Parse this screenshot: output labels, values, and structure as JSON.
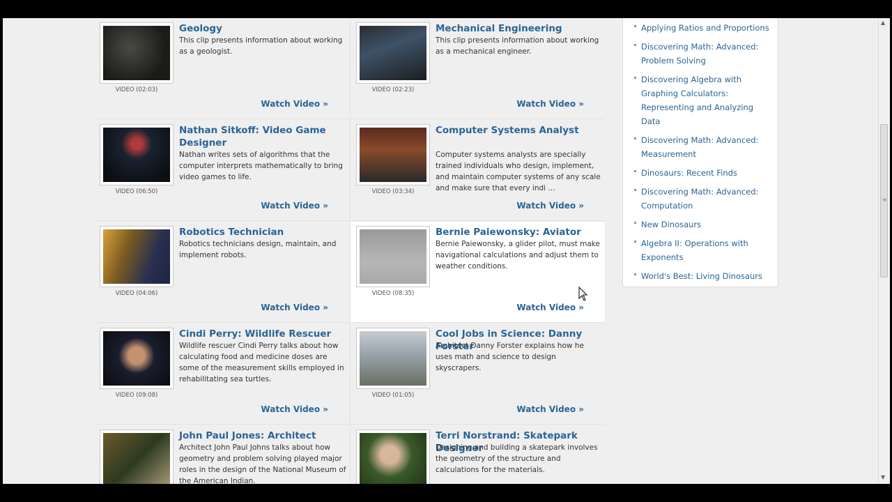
{
  "videos": [
    {
      "title": "Geology",
      "desc": "This clip presents information about working as a geologist.",
      "duration": "VIDEO (02:03)",
      "watch": "Watch Video »",
      "thumb": "t-geology"
    },
    {
      "title": "Mechanical Engineering",
      "desc": "This clip presents information about working as a mechanical engineer.",
      "duration": "VIDEO (02:23)",
      "watch": "Watch Video »",
      "thumb": "t-mech"
    },
    {
      "title": "Nathan Sitkoff: Video Game Designer",
      "desc": "Nathan writes sets of algorithms that the computer interprets mathematically to bring video games to life.",
      "duration": "VIDEO (06:50)",
      "watch": "Watch Video »",
      "thumb": "t-nathan"
    },
    {
      "title": "Computer Systems Analyst",
      "desc": "Computer systems analysts are specially trained individuals who design, implement, and maintain computer systems of any scale and make sure that every indi ...",
      "duration": "VIDEO (03:34)",
      "watch": "Watch Video »",
      "thumb": "t-systems"
    },
    {
      "title": "Robotics Technician",
      "desc": "Robotics technicians design, maintain, and implement robots.",
      "duration": "VIDEO (04:06)",
      "watch": "Watch Video »",
      "thumb": "t-robotics"
    },
    {
      "title": "Bernie Paiewonsky: Aviator",
      "desc": "Bernie Paiewonsky, a glider pilot, must make navigational calculations and adjust them to weather conditions.",
      "duration": "VIDEO (08:35)",
      "watch": "Watch Video »",
      "thumb": "t-bernie"
    },
    {
      "title": "Cindi Perry: Wildlife Rescuer",
      "desc": "Wildlife rescuer Cindi Perry talks about how calculating food and medicine doses are some of the measurement skills employed in rehabilitating sea turtles.",
      "duration": "VIDEO (09:08)",
      "watch": "Watch Video »",
      "thumb": "t-cindi"
    },
    {
      "title": "Cool Jobs in Science: Danny Forster",
      "desc": "Architect Danny Forster explains how he uses math and science to design skyscrapers.",
      "duration": "VIDEO (01:05)",
      "watch": "Watch Video »",
      "thumb": "t-danny"
    },
    {
      "title": "John Paul Jones: Architect",
      "desc": "Architect John Paul Johns talks about how geometry and problem solving played major roles in the design of the National Museum of the American Indian.",
      "duration": "",
      "watch": "",
      "thumb": "t-john"
    },
    {
      "title": "Terri Norstrand: Skatepark Designer",
      "desc": "Designing and building a skatepark involves the geometry of the structure and calculations for the materials.",
      "duration": "",
      "watch": "",
      "thumb": "t-terri"
    }
  ],
  "sidebar": {
    "items": [
      "Applying Ratios and Proportions",
      "Discovering Math: Advanced: Problem Solving",
      "Discovering Algebra with Graphing Calculators: Representing and Analyzing Data",
      "Discovering Math: Advanced: Measurement",
      "Dinosaurs: Recent Finds",
      "Discovering Math: Advanced: Computation",
      "New Dinosaurs",
      "Algebra II: Operations with Exponents",
      "World's Best: Living Dinosaurs"
    ]
  },
  "colors": {
    "link": "#2a6496",
    "background": "#efefef",
    "hover_cell": "#ffffff"
  }
}
